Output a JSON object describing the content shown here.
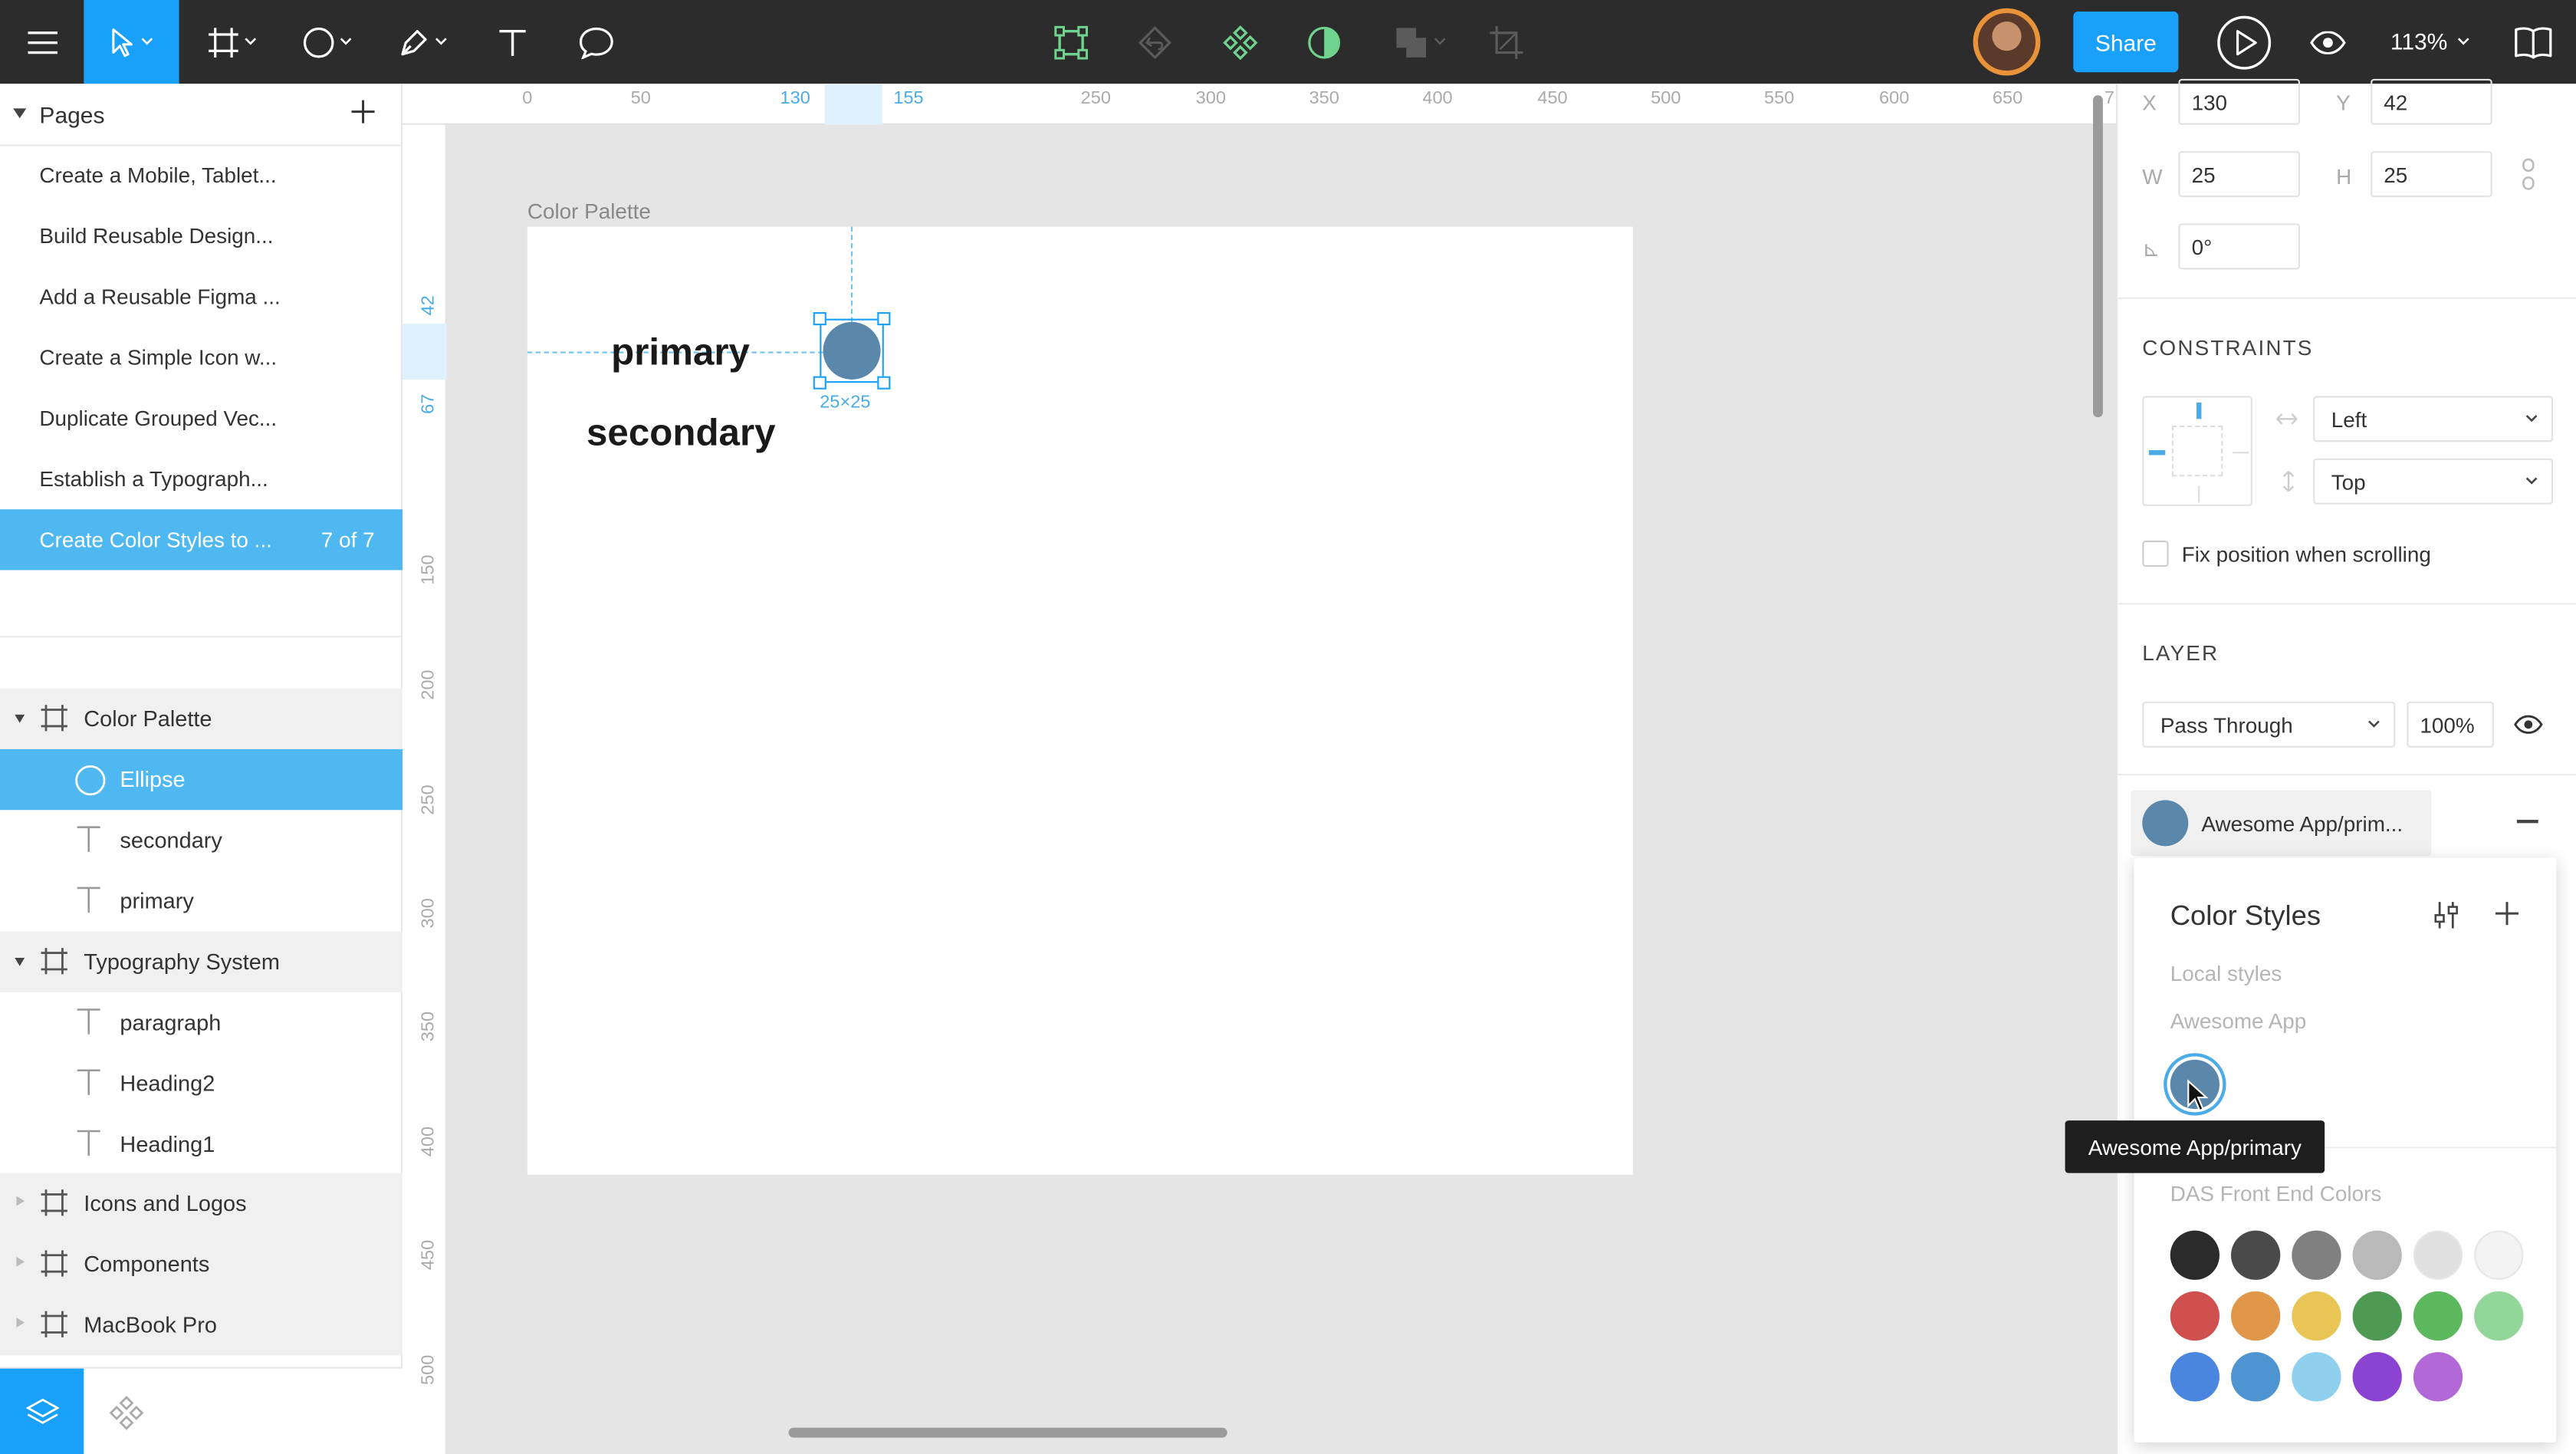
{
  "toolbar": {
    "share_label": "Share",
    "zoom": "113%",
    "icons": [
      "menu-icon",
      "move-tool-icon",
      "frame-tool-icon",
      "ellipse-tool-icon",
      "pen-tool-icon",
      "text-tool-icon",
      "comment-tool-icon",
      "edit-object-icon",
      "reset-instance-icon",
      "component-icon",
      "mask-icon",
      "boolean-icon",
      "crop-icon",
      "play-icon",
      "eye-icon",
      "library-icon"
    ]
  },
  "pages": {
    "title": "Pages",
    "items": [
      {
        "label": "Create a Mobile, Tablet..."
      },
      {
        "label": "Build Reusable Design..."
      },
      {
        "label": "Add a Reusable Figma ..."
      },
      {
        "label": "Create a Simple Icon w..."
      },
      {
        "label": "Duplicate Grouped Vec..."
      },
      {
        "label": "Establish a Typograph..."
      },
      {
        "label": "Create Color Styles to ...",
        "count": "7 of 7"
      }
    ]
  },
  "layers": {
    "color_palette": "Color Palette",
    "ellipse": "Ellipse",
    "secondary": "secondary",
    "primary": "primary",
    "typography_system": "Typography System",
    "paragraph": "paragraph",
    "heading2": "Heading2",
    "heading1": "Heading1",
    "icons_and_logos": "Icons and Logos",
    "components": "Components",
    "macbook_pro": "MacBook Pro"
  },
  "ruler": {
    "top_ticks": [
      "0",
      "50",
      "130",
      "155",
      "250",
      "300",
      "350",
      "400",
      "450",
      "500",
      "550",
      "600",
      "650",
      "7"
    ],
    "left_ticks": [
      "42",
      "67",
      "150",
      "200",
      "250",
      "300",
      "350",
      "400",
      "450",
      "500"
    ]
  },
  "canvas": {
    "frame_label": "Color Palette",
    "primary_text": "primary",
    "secondary_text": "secondary",
    "size_label": "25×25"
  },
  "properties": {
    "x_label": "X",
    "x_value": "130",
    "y_label": "Y",
    "y_value": "42",
    "w_label": "W",
    "w_value": "25",
    "h_label": "H",
    "h_value": "25",
    "rotation_label": "⊾",
    "rotation_value": "0°",
    "constraints_title": "CONSTRAINTS",
    "horizontal": "Left",
    "vertical": "Top",
    "fix_position": "Fix position when scrolling",
    "layer_title": "LAYER",
    "blend_mode": "Pass Through",
    "opacity": "100%",
    "fill_label": "Awesome App/prim..."
  },
  "color_styles": {
    "title": "Color Styles",
    "local_styles": "Local styles",
    "awesome_app": "Awesome App",
    "tooltip": "Awesome App/primary",
    "das_title": "DAS Front End Colors",
    "primary_color": "#5b87ab",
    "das_colors": [
      [
        "#2b2b2b",
        "#4a4a4a",
        "#808080",
        "#b9b9b9",
        "#e0e0e0",
        "#f3f3f3"
      ],
      [
        "#d05050",
        "#e0974a",
        "#e8c554",
        "#4e9a52",
        "#5cb85c",
        "#93d69a"
      ],
      [
        "#4a86e0",
        "#4d94d0",
        "#8fd0ee",
        "#8b44d2",
        "#b368d8"
      ]
    ]
  }
}
